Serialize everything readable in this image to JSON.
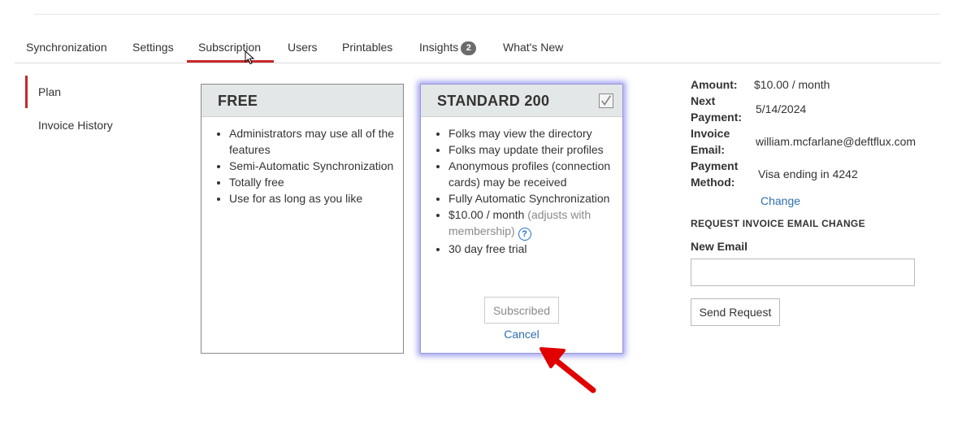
{
  "tabs": [
    {
      "label": "Synchronization"
    },
    {
      "label": "Settings"
    },
    {
      "label": "Subscription",
      "active": true
    },
    {
      "label": "Users"
    },
    {
      "label": "Printables"
    },
    {
      "label": "Insights",
      "badge": "2"
    },
    {
      "label": "What's New"
    }
  ],
  "sidebar": {
    "items": [
      {
        "label": "Plan",
        "active": true
      },
      {
        "label": "Invoice History"
      }
    ]
  },
  "plans": {
    "free": {
      "title": "FREE",
      "features": [
        "Administrators may use all of the features",
        "Semi-Automatic Synchronization",
        "Totally free",
        "Use for as long as you like"
      ]
    },
    "standard": {
      "title": "STANDARD 200",
      "selected": true,
      "features": [
        "Folks may view the directory",
        "Folks may update their profiles",
        "Anonymous profiles (connection cards) may be received",
        "Fully Automatic Synchronization"
      ],
      "price": "$10.00 / month",
      "price_note": "(adjusts with membership)",
      "trial": "30 day free trial",
      "subscribed_label": "Subscribed",
      "cancel_label": "Cancel"
    }
  },
  "billing": {
    "amount_label": "Amount:",
    "amount_value": "$10.00 / month",
    "next_label_1": "Next",
    "next_label_2": "Payment:",
    "next_value": "5/14/2024",
    "invoice_label_1": "Invoice",
    "invoice_label_2": "Email:",
    "invoice_value": "william.mcfarlane@deftflux.com",
    "method_label_1": "Payment",
    "method_label_2": "Method:",
    "method_value": "Visa ending in 4242",
    "change_label": "Change"
  },
  "request": {
    "title": "REQUEST INVOICE EMAIL CHANGE",
    "email_label": "New Email",
    "email_value": "",
    "send_label": "Send Request"
  },
  "colors": {
    "accent": "#c62828",
    "link": "#2f6fb0",
    "highlight_glow": "#5050e6",
    "annotation_arrow": "#e00000"
  }
}
